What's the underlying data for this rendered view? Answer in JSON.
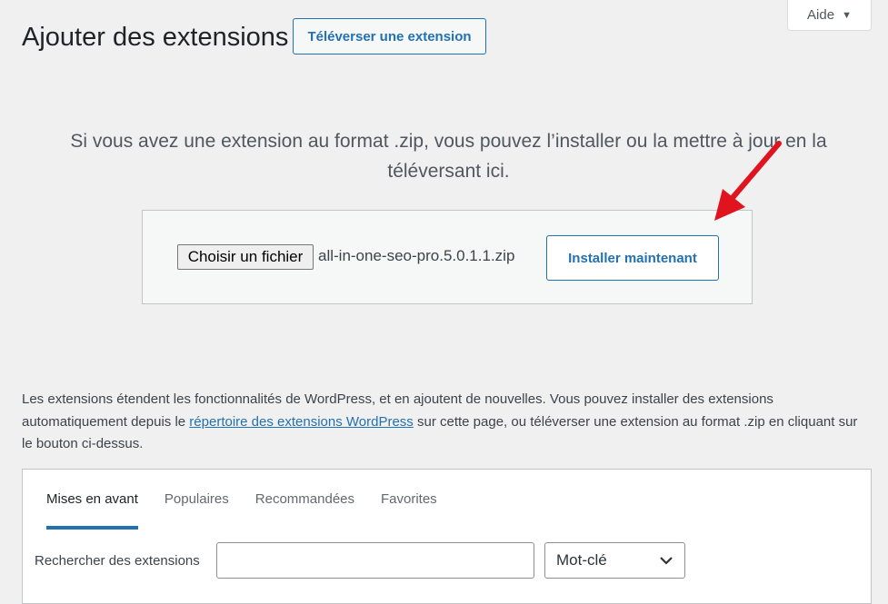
{
  "help": {
    "label": "Aide",
    "icon": "caret-down-icon"
  },
  "header": {
    "title": "Ajouter des extensions",
    "upload_button": "Téléverser une extension"
  },
  "upload": {
    "description": "Si vous avez une extension au format .zip, vous pouvez l’installer ou la mettre à jour en la téléversant ici.",
    "choose_file_button": "Choisir un fichier",
    "file_name": "all-in-one-seo-pro.5.0.1.1.zip",
    "install_button": "Installer maintenant",
    "arrow_color": "#e0141e"
  },
  "info": {
    "text_before": "Les extensions étendent les fonctionnalités de WordPress, et en ajoutent de nouvelles. Vous pouvez installer des extensions automatiquement depuis le ",
    "link": "répertoire des extensions WordPress",
    "text_after": " sur cette page, ou téléverser une extension au format .zip en cliquant sur le bouton ci-dessus."
  },
  "filters": {
    "tabs": [
      {
        "label": "Mises en avant",
        "active": true
      },
      {
        "label": "Populaires",
        "active": false
      },
      {
        "label": "Recommandées",
        "active": false
      },
      {
        "label": "Favorites",
        "active": false
      }
    ],
    "search_label": "Rechercher des extensions",
    "search_value": "",
    "search_type": "Mot-clé"
  },
  "colors": {
    "accent": "#2271b1",
    "background": "#f0f0f1"
  }
}
